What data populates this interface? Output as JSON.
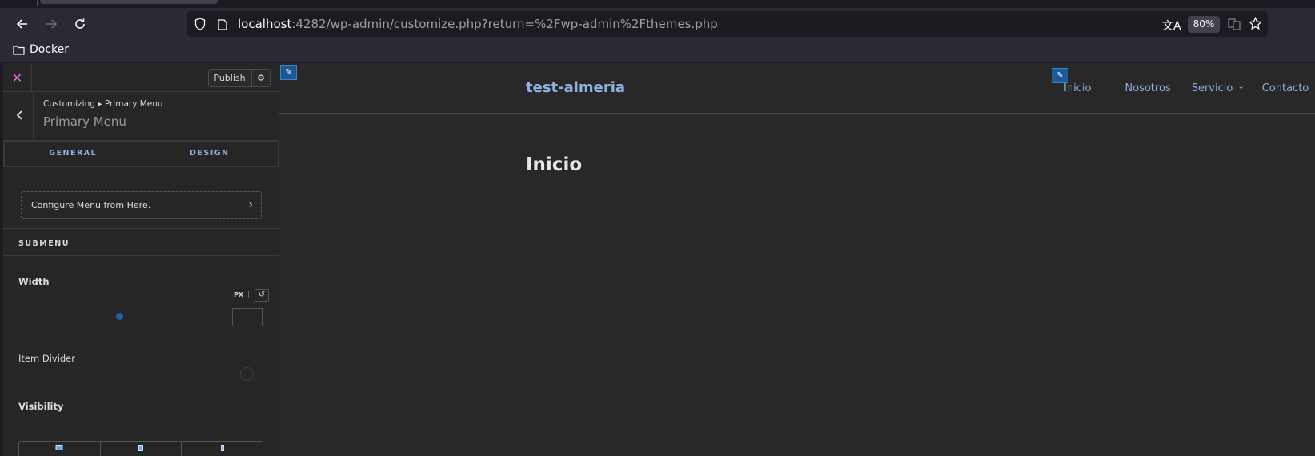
{
  "browser": {
    "url_host": "localhost",
    "url_rest": ":4282/wp-admin/customize.php?return=%2Fwp-admin%2Fthemes.php",
    "zoom": "80%",
    "bookmark_folder": "Docker"
  },
  "customizer": {
    "publish_label": "Publish",
    "breadcrumb": "Customizing ▸ Primary Menu",
    "section_title": "Primary Menu",
    "tabs": [
      "GENERAL",
      "DESIGN"
    ],
    "configure_menu_label": "Configure Menu from Here.",
    "submenu_heading": "SUBMENU",
    "width_label": "Width",
    "width_unit": "PX",
    "item_divider_label": "Item Divider",
    "visibility_label": "Visibility"
  },
  "preview": {
    "site_title": "test-almeria",
    "menu": [
      "Inicio",
      "Nosotros",
      "Servicio",
      "Contacto"
    ],
    "page_title": "Inicio"
  },
  "colors": {
    "accent": "#8fb1e0",
    "close_icon": "#d96bd9",
    "edit_shortcut": "#1c5a96"
  }
}
